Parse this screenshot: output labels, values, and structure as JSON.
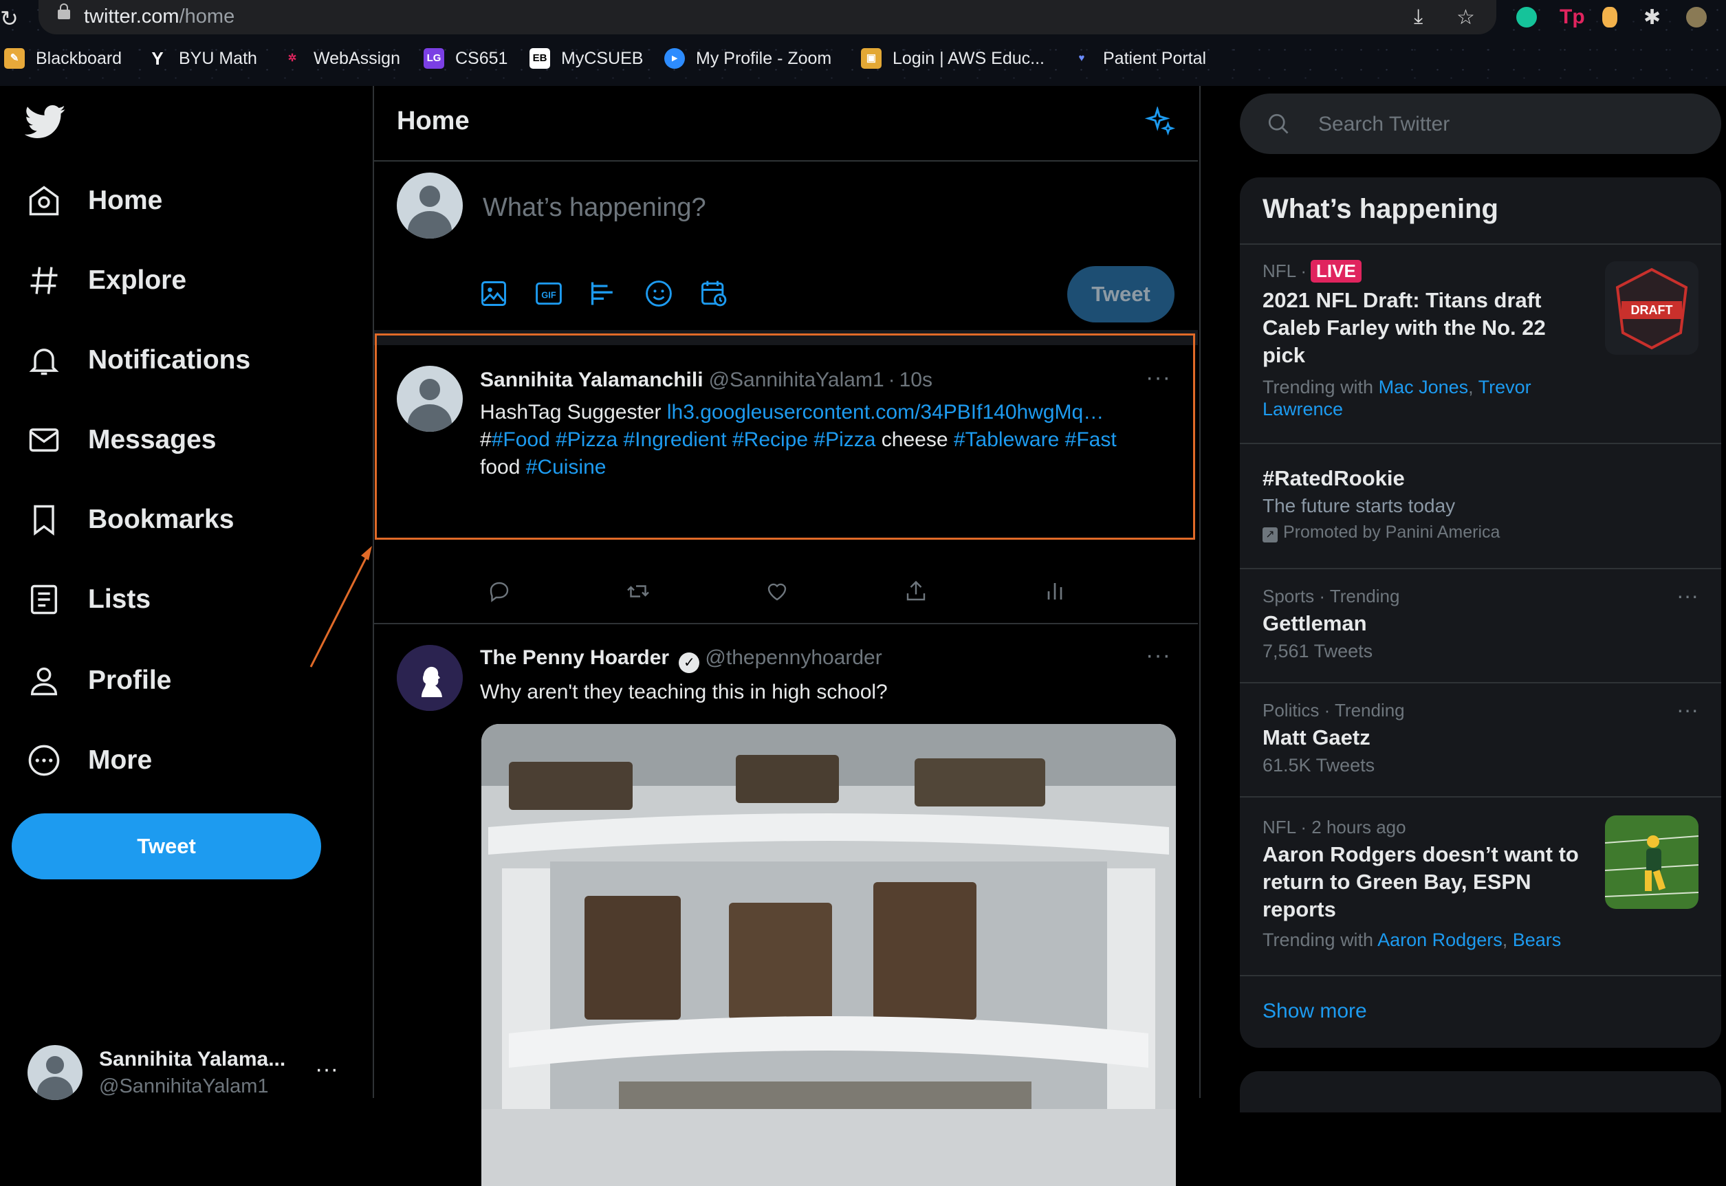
{
  "browser": {
    "url_host": "twitter.com",
    "url_path": "/home",
    "bookmarks": [
      "Blackboard",
      "BYU Math",
      "WebAssign",
      "CS651",
      "MyCSUEB",
      "My Profile - Zoom",
      "Login | AWS Educ...",
      "Patient Portal"
    ]
  },
  "nav": {
    "items": [
      "Home",
      "Explore",
      "Notifications",
      "Messages",
      "Bookmarks",
      "Lists",
      "Profile",
      "More"
    ],
    "tweet_label": "Tweet",
    "user_name": "Sannihita Yalama...",
    "user_handle": "@SannihitaYalam1"
  },
  "center": {
    "title": "Home",
    "composer_placeholder": "What’s happening?",
    "tweet_label": "Tweet"
  },
  "tweets": [
    {
      "name": "Sannihita Yalamanchili",
      "handle": "@SannihitaYalam1",
      "time": "10s",
      "text_prefix": "HashTag Suggester ",
      "link": "lh3.googleusercontent.com/34PBIf140hwgMq…",
      "line2": [
        {
          "t": "#",
          "link": false
        },
        {
          "t": "#Food",
          "link": true
        },
        {
          "t": " ",
          "link": false
        },
        {
          "t": "#Pizza",
          "link": true
        },
        {
          "t": " ",
          "link": false
        },
        {
          "t": "#Ingredient",
          "link": true
        },
        {
          "t": " ",
          "link": false
        },
        {
          "t": "#Recipe",
          "link": true
        },
        {
          "t": " ",
          "link": false
        },
        {
          "t": "#Pizza",
          "link": true
        },
        {
          "t": " cheese ",
          "link": false
        },
        {
          "t": "#Tableware",
          "link": true
        },
        {
          "t": " ",
          "link": false
        },
        {
          "t": "#Fast",
          "link": true
        }
      ],
      "line3_prefix": "food ",
      "line3_tag": "#Cuisine"
    },
    {
      "name": "The Penny Hoarder",
      "handle": "@thepennyhoarder",
      "text": "Why aren't they teaching this in high school?"
    }
  ],
  "search": {
    "placeholder": "Search Twitter"
  },
  "trends": {
    "title": "What’s happening",
    "items": [
      {
        "meta": "NFL ·",
        "live": "LIVE",
        "topic": "2021 NFL Draft: Titans draft Caleb Farley with the No. 22 pick",
        "trending_with": "Trending with",
        "links": [
          "Mac Jones",
          "Trevor Lawrence"
        ],
        "thumb_text": "DRAFT"
      },
      {
        "topic": "#RatedRookie",
        "desc": "The future starts today",
        "promoted": "Promoted by Panini America"
      },
      {
        "meta": "Sports · Trending",
        "topic": "Gettleman",
        "count": "7,561 Tweets"
      },
      {
        "meta": "Politics · Trending",
        "topic": "Matt Gaetz",
        "count": "61.5K Tweets"
      },
      {
        "meta": "NFL · 2 hours ago",
        "topic": "Aaron Rodgers doesn’t want to return to Green Bay, ESPN reports",
        "trending_with": "Trending with",
        "links": [
          "Aaron Rodgers",
          "Bears"
        ]
      }
    ],
    "show_more": "Show more"
  },
  "colors": {
    "accent": "#1d9bf0",
    "highlight": "#e06a28",
    "live": "#e0245e"
  }
}
